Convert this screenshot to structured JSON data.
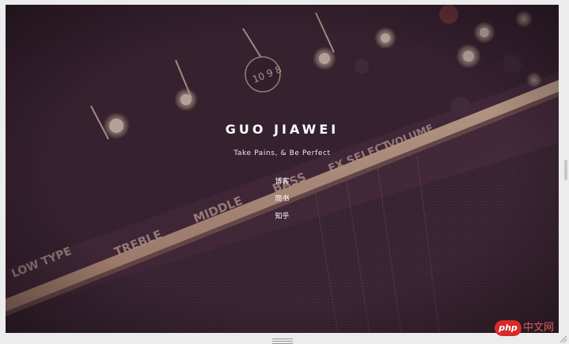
{
  "site": {
    "title": "GUO JIAWEI",
    "tagline": "Take Pains, & Be Perfect"
  },
  "nav": {
    "items": [
      {
        "label": "博客"
      },
      {
        "label": "简书"
      },
      {
        "label": "知乎"
      }
    ]
  },
  "watermark": {
    "badge": "php",
    "text": "中文网"
  },
  "colors": {
    "hero_background": "#3a2532",
    "overlay_tint": "#4a2c3f",
    "text": "#ffffff",
    "watermark_red": "#d92a2a"
  },
  "background_image": {
    "subject": "guitar amplifier control panel with knobs",
    "visible_panel_labels": [
      "BASS",
      "MIDDLE",
      "TREBLE",
      "FX SELECT",
      "VOLUME",
      "LOW TYPE"
    ]
  }
}
